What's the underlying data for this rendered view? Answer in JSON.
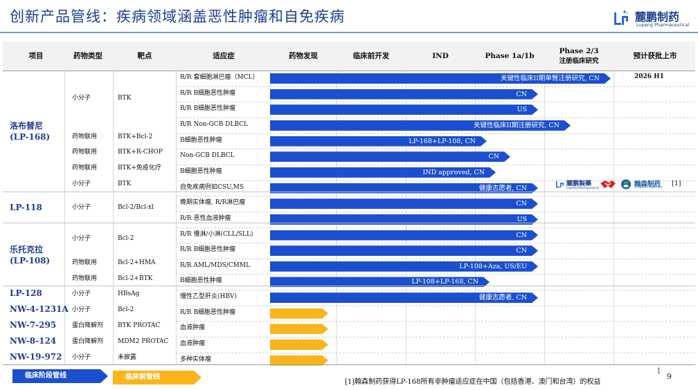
{
  "title": "创新产品管线：疾病领域涵盖恶性肿瘤和自免疾病",
  "logo": {
    "name_cn": "麓鹏制药",
    "name_en": "Lupeng Pharmaceutical"
  },
  "headers": [
    "项目",
    "药物类型",
    "靶点",
    "适应症",
    "药物发现",
    "临床前开发",
    "IND",
    "Phase 1a/1b",
    "Phase 2/3",
    "注册临床研究",
    "预计获批上市"
  ],
  "drugs": [
    {
      "name1": "洛布替尼",
      "name2": "(LP-168)"
    },
    {
      "name1": "LP-118",
      "name2": ""
    },
    {
      "name1": "乐托克拉",
      "name2": "(LP-108)"
    },
    {
      "name1": "LP-128",
      "name2": ""
    },
    {
      "name1": "NW-4-1231A",
      "name2": ""
    },
    {
      "name1": "NW-7-295",
      "name2": ""
    },
    {
      "name1": "NW-8-124",
      "name2": ""
    },
    {
      "name1": "NW-19-972",
      "name2": ""
    }
  ],
  "type_cells": [
    "小分子",
    "药物联用",
    "药物联用",
    "药物联用",
    "小分子",
    "小分子",
    "小分子",
    "药物联用",
    "药物联用",
    "小分子",
    "小分子",
    "蛋白降解剂",
    "蛋白降解剂",
    "小分子"
  ],
  "target_cells": [
    "BTK",
    "BTK+Bcl-2",
    "BTK+R-CHOP",
    "BTK+免疫化疗",
    "BTK",
    "Bcl-2/Bcl-xl",
    "Bcl-2",
    "Bcl-2+HMA",
    "Bcl-2+BTK",
    "HBsAg",
    "Bcl-2",
    "BTK PROTAC",
    "MDM2 PROTAC",
    "未披露"
  ],
  "rows": [
    {
      "indication": "R/R 套细胞淋巴瘤（MCL）",
      "label": "关键性临床II期单臂注册研究, CN",
      "color": "blue",
      "progress": 0.992
    },
    {
      "indication": "R/R B细胞恶性肿瘤",
      "label": "CN",
      "color": "blue",
      "progress": 0.781
    },
    {
      "indication": "R/R B细胞恶性肿瘤",
      "label": "US",
      "color": "blue",
      "progress": 0.781
    },
    {
      "indication": "R/R Non-GCB DLBCL",
      "label": "关键性临床II期注册研究, CN",
      "color": "blue",
      "progress": 0.875
    },
    {
      "indication": "B细胞恶性肿瘤",
      "label": "LP-168+LP-108, CN",
      "color": "blue",
      "progress": 0.632
    },
    {
      "indication": "Non-GCB DLBCL",
      "label": "CN",
      "color": "blue",
      "progress": 0.7
    },
    {
      "indication": "B细胞恶性肿瘤",
      "label": "IND approved, CN",
      "color": "blue",
      "progress": 0.658
    },
    {
      "indication": "自免疾病例如CSU,MS",
      "label": "健康志愿者, CN",
      "color": "blue",
      "progress": 0.781
    },
    {
      "indication": "晚期实体瘤, R/R淋巴瘤",
      "label": "CN",
      "color": "blue",
      "progress": 0.781
    },
    {
      "indication": "R/R 恶性血液肿瘤",
      "label": "US",
      "color": "blue",
      "progress": 0.781
    },
    {
      "indication": "R/R 慢淋/小淋(CLL/SLL)",
      "label": "CN",
      "color": "blue",
      "progress": 0.781
    },
    {
      "indication": "R/R B细胞恶性肿瘤",
      "label": "CN",
      "color": "blue",
      "progress": 0.781
    },
    {
      "indication": "R/R AML/MDS/CMML",
      "label": "LP-108+Aza, US/EU",
      "color": "blue",
      "progress": 0.781
    },
    {
      "indication": "B细胞恶性肿瘤",
      "label": "LP-108+LP-168, CN",
      "color": "blue",
      "progress": 0.639
    },
    {
      "indication": "慢性乙型肝炎(HBV)",
      "label": "健康志愿者, CN",
      "color": "blue",
      "progress": 0.781
    },
    {
      "indication": "R/R B细胞恶性肿瘤",
      "label": "",
      "color": "orange",
      "progress": 0.169
    },
    {
      "indication": "血液肿瘤",
      "label": "",
      "color": "orange",
      "progress": 0.169
    },
    {
      "indication": "血液肿瘤",
      "label": "",
      "color": "orange",
      "progress": 0.169
    },
    {
      "indication": "多种实体瘤",
      "label": "",
      "color": "orange",
      "progress": 0.169
    }
  ],
  "approval": "2026 H1",
  "partners": {
    "logo1_cn": "麓鹏製藥",
    "logo1_en": "Lupeng Pharmaceutical",
    "logo3_cn": "翰森制药",
    "logo3_en": "HANSOH PHARMA",
    "note": "[1]"
  },
  "legend": {
    "clinical": "临床阶段管线",
    "preclinical": "临床前管线",
    "colors": {
      "clinical": "#1b4fcf",
      "preclinical": "#f9b51b"
    }
  },
  "footnote": "[1]翰森制药获得LP-168所有非肿瘤适应症在中国（包括香港、澳门和台湾）的权益",
  "page": {
    "small": "1",
    "number": "9"
  },
  "colors": {
    "title": "#1d3f8f",
    "blue": "#1b4fcf",
    "orange": "#f9b51b"
  }
}
